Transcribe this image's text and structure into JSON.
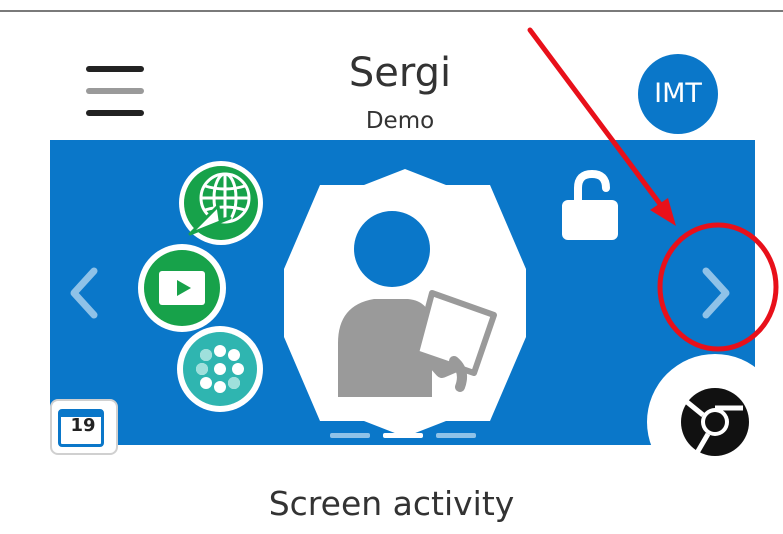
{
  "header": {
    "title": "Sergi",
    "subtitle": "Demo",
    "avatar_initials": "IMT"
  },
  "icons": {
    "menu": "hamburger-icon",
    "web": "globe-cursor-icon",
    "video": "video-play-icon",
    "apps": "app-grid-icon",
    "profile": "person-tablet-icon",
    "lock": "unlocked-padlock-icon",
    "calendar": "calendar-icon",
    "browser": "chrome-icon",
    "prev": "chevron-left-icon",
    "next": "chevron-right-icon"
  },
  "calendar": {
    "day": "19"
  },
  "carousel": {
    "pages": 3,
    "active_page": 2
  },
  "caption": "Screen activity",
  "colors": {
    "brand_blue": "#0a77c9",
    "green": "#17a24a",
    "teal": "#2fb5b0",
    "annotation_red": "#e8101a"
  }
}
